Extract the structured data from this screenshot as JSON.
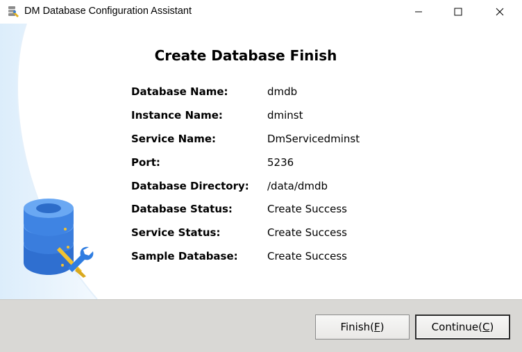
{
  "window": {
    "title": "DM Database Configuration Assistant",
    "app_icon": "database-wizard-icon",
    "controls": {
      "minimize": "minimize-icon",
      "maximize": "maximize-icon",
      "close": "close-icon"
    }
  },
  "main": {
    "heading": "Create Database Finish",
    "rows": [
      {
        "label": "Database Name:",
        "value": "dmdb"
      },
      {
        "label": "Instance Name:",
        "value": "dminst"
      },
      {
        "label": "Service Name:",
        "value": "DmServicedminst"
      },
      {
        "label": "Port:",
        "value": "5236"
      },
      {
        "label": "Database Directory:",
        "value": "/data/dmdb"
      },
      {
        "label": "Database Status:",
        "value": "Create Success"
      },
      {
        "label": "Service Status:",
        "value": "Create Success"
      },
      {
        "label": "Sample Database:",
        "value": "Create Success"
      }
    ],
    "illustration": "database-tools-icon"
  },
  "footer": {
    "finish": {
      "label": "Finish(",
      "mnemonic": "F",
      "suffix": ")"
    },
    "continue": {
      "label": "Continue(",
      "mnemonic": "C",
      "suffix": ")"
    }
  },
  "colors": {
    "accent_blue": "#2f7de1",
    "panel_light_blue": "#e6f2fc",
    "footer_gray": "#d9d8d5",
    "tool_yellow": "#f2c230"
  }
}
